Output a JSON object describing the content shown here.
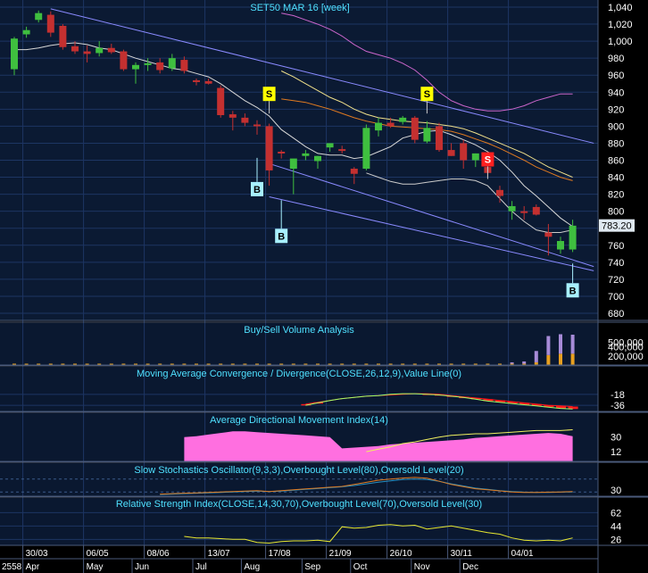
{
  "colors": {
    "panel_bg": "#0b1a33",
    "panel_bg2": "#0a1830",
    "grid": "#1d3563",
    "border": "#4a5a7a",
    "up_candle": "#3fbf3f",
    "down_candle": "#c43030",
    "ma_fast": "#d8d8d8",
    "ma_mid": "#f0e08a",
    "ma_slow": "#e07a20",
    "upper_band": "#cc66cc",
    "lower_band": "#cccccc",
    "trend": "#8a8aff",
    "axis_text": "#ffffff",
    "title_text": "#4fe0ff",
    "volume_buy": "#e8a020",
    "volume_sell": "#a78bd8",
    "macd_line": "#9bff6a",
    "macd_neg": "#ff1a1a",
    "adx_fill": "#ff6fe0",
    "adx_line": "#f0f060",
    "stoch_k": "#e07a20",
    "stoch_d": "#2a8fbf",
    "rsi_line": "#e8e830",
    "price_tag_bg": "#dfe8f0"
  },
  "chart_data": [
    {
      "type": "candlestick",
      "title": "SET50 MAR 16  [week]",
      "ylim": [
        680,
        1040
      ],
      "y_ticks": [
        680,
        700,
        720,
        740,
        760,
        780,
        800,
        820,
        840,
        860,
        880,
        900,
        920,
        940,
        960,
        980,
        1000,
        1020,
        1040
      ],
      "last_price": "783.20",
      "candles": [
        {
          "o": 967,
          "h": 1005,
          "l": 960,
          "c": 1003
        },
        {
          "o": 1008,
          "h": 1017,
          "l": 1004,
          "c": 1013
        },
        {
          "o": 1025,
          "h": 1036,
          "l": 1022,
          "c": 1033
        },
        {
          "o": 1031,
          "h": 1035,
          "l": 1005,
          "c": 1010
        },
        {
          "o": 1018,
          "h": 1020,
          "l": 990,
          "c": 993
        },
        {
          "o": 994,
          "h": 1000,
          "l": 985,
          "c": 988
        },
        {
          "o": 988,
          "h": 995,
          "l": 975,
          "c": 985
        },
        {
          "o": 986,
          "h": 1000,
          "l": 982,
          "c": 992
        },
        {
          "o": 992,
          "h": 997,
          "l": 985,
          "c": 987
        },
        {
          "o": 988,
          "h": 990,
          "l": 965,
          "c": 967
        },
        {
          "o": 967,
          "h": 975,
          "l": 950,
          "c": 972
        },
        {
          "o": 972,
          "h": 980,
          "l": 965,
          "c": 974
        },
        {
          "o": 975,
          "h": 980,
          "l": 962,
          "c": 966
        },
        {
          "o": 968,
          "h": 985,
          "l": 965,
          "c": 980
        },
        {
          "o": 978,
          "h": 982,
          "l": 962,
          "c": 965
        },
        {
          "o": 954,
          "h": 956,
          "l": 948,
          "c": 952
        },
        {
          "o": 953,
          "h": 956,
          "l": 949,
          "c": 950
        },
        {
          "o": 945,
          "h": 948,
          "l": 910,
          "c": 913
        },
        {
          "o": 914,
          "h": 918,
          "l": 895,
          "c": 910
        },
        {
          "o": 910,
          "h": 915,
          "l": 900,
          "c": 904
        },
        {
          "o": 902,
          "h": 907,
          "l": 890,
          "c": 900
        },
        {
          "o": 900,
          "h": 903,
          "l": 830,
          "c": 848
        },
        {
          "o": 870,
          "h": 872,
          "l": 862,
          "c": 868
        },
        {
          "o": 850,
          "h": 858,
          "l": 820,
          "c": 862
        },
        {
          "o": 865,
          "h": 872,
          "l": 860,
          "c": 868
        },
        {
          "o": 859,
          "h": 865,
          "l": 850,
          "c": 865
        },
        {
          "o": 875,
          "h": 880,
          "l": 870,
          "c": 880
        },
        {
          "o": 873,
          "h": 877,
          "l": 868,
          "c": 872
        },
        {
          "o": 850,
          "h": 852,
          "l": 832,
          "c": 844
        },
        {
          "o": 850,
          "h": 902,
          "l": 848,
          "c": 898
        },
        {
          "o": 895,
          "h": 910,
          "l": 888,
          "c": 904
        },
        {
          "o": 904,
          "h": 910,
          "l": 898,
          "c": 900
        },
        {
          "o": 905,
          "h": 912,
          "l": 902,
          "c": 910
        },
        {
          "o": 910,
          "h": 912,
          "l": 880,
          "c": 884
        },
        {
          "o": 882,
          "h": 906,
          "l": 880,
          "c": 898
        },
        {
          "o": 900,
          "h": 904,
          "l": 870,
          "c": 872
        },
        {
          "o": 872,
          "h": 880,
          "l": 865,
          "c": 865
        },
        {
          "o": 880,
          "h": 884,
          "l": 850,
          "c": 860
        },
        {
          "o": 860,
          "h": 868,
          "l": 852,
          "c": 868
        },
        {
          "o": 852,
          "h": 855,
          "l": 840,
          "c": 845
        },
        {
          "o": 825,
          "h": 830,
          "l": 810,
          "c": 818
        },
        {
          "o": 800,
          "h": 812,
          "l": 790,
          "c": 806
        },
        {
          "o": 800,
          "h": 806,
          "l": 790,
          "c": 798
        },
        {
          "o": 805,
          "h": 808,
          "l": 795,
          "c": 796
        },
        {
          "o": 775,
          "h": 785,
          "l": 748,
          "c": 770
        },
        {
          "o": 755,
          "h": 770,
          "l": 750,
          "c": 765
        },
        {
          "o": 755,
          "h": 790,
          "l": 752,
          "c": 783
        }
      ],
      "ma_fast": [
        990,
        990,
        992,
        995,
        997,
        998,
        996,
        992,
        990,
        985,
        980,
        976,
        972,
        968,
        966,
        962,
        958,
        950,
        940,
        930,
        922,
        912,
        896,
        886,
        876,
        868,
        866,
        866,
        862,
        864,
        870,
        876,
        886,
        890,
        894,
        895,
        890,
        884,
        878,
        870,
        860,
        846,
        830,
        818,
        805,
        792,
        782
      ],
      "ma_mid": [
        null,
        null,
        null,
        null,
        null,
        null,
        null,
        null,
        null,
        null,
        null,
        null,
        null,
        null,
        null,
        null,
        null,
        null,
        null,
        null,
        null,
        null,
        965,
        958,
        950,
        942,
        934,
        928,
        920,
        914,
        910,
        908,
        906,
        905,
        904,
        902,
        900,
        897,
        892,
        886,
        880,
        874,
        868,
        860,
        852,
        846,
        840
      ],
      "ma_slow": [
        null,
        null,
        null,
        null,
        null,
        null,
        null,
        null,
        null,
        null,
        null,
        null,
        null,
        null,
        null,
        null,
        null,
        null,
        null,
        null,
        null,
        null,
        932,
        930,
        928,
        924,
        920,
        915,
        910,
        906,
        903,
        900,
        899,
        898,
        897,
        896,
        894,
        890,
        885,
        880,
        874,
        867,
        860,
        852,
        846,
        840,
        836
      ],
      "upper_band": [
        null,
        null,
        null,
        null,
        null,
        null,
        null,
        null,
        null,
        null,
        null,
        null,
        null,
        null,
        null,
        null,
        null,
        null,
        null,
        null,
        null,
        null,
        1033,
        1030,
        1025,
        1020,
        1014,
        1006,
        996,
        988,
        984,
        980,
        974,
        966,
        954,
        940,
        930,
        924,
        920,
        918,
        918,
        920,
        924,
        930,
        934,
        938,
        938
      ],
      "lower_band": [
        null,
        null,
        null,
        null,
        null,
        null,
        null,
        null,
        null,
        null,
        null,
        null,
        null,
        null,
        null,
        null,
        null,
        null,
        null,
        null,
        null,
        null,
        null,
        null,
        null,
        null,
        null,
        null,
        null,
        845,
        840,
        835,
        832,
        832,
        834,
        836,
        838,
        838,
        836,
        830,
        815,
        800,
        788,
        778,
        775,
        775,
        778
      ],
      "trend_lines": [
        {
          "x0": 3,
          "y0": 1038,
          "x1": 47,
          "y1": 880
        },
        {
          "x0": 21,
          "y0": 856,
          "x1": 47,
          "y1": 735
        },
        {
          "x0": 21,
          "y0": 817,
          "x1": 47,
          "y1": 730
        }
      ],
      "signals": [
        {
          "i": 21,
          "label": "S",
          "type": "sell-yellow",
          "price": 938
        },
        {
          "i": 34,
          "label": "S",
          "type": "sell-yellow",
          "price": 938
        },
        {
          "i": 39,
          "label": "S",
          "type": "sell-red",
          "price": 861
        },
        {
          "i": 20,
          "label": "B",
          "type": "buy",
          "price": 826
        },
        {
          "i": 22,
          "label": "B",
          "type": "buy",
          "price": 771
        },
        {
          "i": 46,
          "label": "B",
          "type": "buy",
          "price": 707
        }
      ],
      "x_ticks": [
        {
          "i": 1,
          "label": "30/03"
        },
        {
          "i": 6,
          "label": "06/05"
        },
        {
          "i": 11,
          "label": "08/06"
        },
        {
          "i": 16,
          "label": "13/07"
        },
        {
          "i": 21,
          "label": "17/08"
        },
        {
          "i": 26,
          "label": "21/09"
        },
        {
          "i": 31,
          "label": "26/10"
        },
        {
          "i": 36,
          "label": "30/11"
        },
        {
          "i": 41,
          "label": "04/01"
        }
      ],
      "month_ticks": [
        {
          "i": 1,
          "label": "Apr"
        },
        {
          "i": 6,
          "label": "May"
        },
        {
          "i": 10,
          "label": "Jun"
        },
        {
          "i": 15,
          "label": "Jul"
        },
        {
          "i": 19,
          "label": "Aug"
        },
        {
          "i": 24,
          "label": "Sep"
        },
        {
          "i": 28,
          "label": "Oct"
        },
        {
          "i": 33,
          "label": "Nov"
        },
        {
          "i": 37,
          "label": "Dec"
        }
      ],
      "year_label": "2558"
    },
    {
      "type": "bar",
      "title": "Buy/Sell Volume Analysis",
      "y_ticks": [
        200000,
        400000,
        500000
      ],
      "y_tick_labels": [
        "200,000",
        "400,000",
        "500,000"
      ],
      "ylim": [
        0,
        650000
      ],
      "buy": [
        30000,
        30000,
        30000,
        30000,
        30000,
        30000,
        30000,
        30000,
        30000,
        30000,
        30000,
        30000,
        30000,
        30000,
        30000,
        30000,
        30000,
        30000,
        30000,
        30000,
        30000,
        30000,
        30000,
        30000,
        30000,
        30000,
        30000,
        30000,
        30000,
        30000,
        30000,
        30000,
        30000,
        30000,
        30000,
        30000,
        30000,
        30000,
        30000,
        30000,
        30000,
        30000,
        30000,
        60000,
        220000,
        250000,
        250000
      ],
      "sell": [
        0,
        0,
        0,
        0,
        0,
        0,
        0,
        0,
        0,
        0,
        0,
        0,
        0,
        0,
        0,
        0,
        0,
        0,
        0,
        0,
        0,
        0,
        0,
        0,
        0,
        0,
        0,
        0,
        0,
        0,
        0,
        0,
        0,
        0,
        0,
        0,
        0,
        0,
        0,
        0,
        0,
        30000,
        50000,
        250000,
        420000,
        430000,
        420000
      ]
    },
    {
      "type": "line",
      "title": "Moving Average Convergence / Divergence(CLOSE,26,12,9),Value Line(0)",
      "y_ticks": [
        -18,
        -36
      ],
      "ylim": [
        -46,
        8
      ],
      "macd": [
        null,
        null,
        null,
        null,
        null,
        null,
        null,
        null,
        null,
        null,
        null,
        null,
        null,
        null,
        null,
        null,
        null,
        null,
        null,
        null,
        null,
        null,
        null,
        null,
        -36,
        -32,
        -28,
        -25,
        -23,
        -21,
        -20,
        -18,
        -17,
        -17,
        -18,
        -19,
        -21,
        -23,
        -26,
        -29,
        -31,
        -33,
        -35,
        -37,
        -39,
        -41,
        -42
      ],
      "signal": [
        null,
        null,
        null,
        null,
        null,
        null,
        null,
        null,
        null,
        null,
        null,
        null,
        null,
        null,
        null,
        null,
        null,
        null,
        null,
        null,
        null,
        null,
        null,
        null,
        -34,
        -31,
        -28,
        -25,
        -23,
        -21,
        -20,
        -19,
        -18,
        -17,
        -17,
        -18,
        -20,
        -22,
        -24,
        -26,
        -28,
        -30,
        -32,
        -34,
        -36,
        -37,
        -38
      ]
    },
    {
      "type": "area",
      "title": "Average Directional Movement Index(14)",
      "y_ticks": [
        12,
        30
      ],
      "ylim": [
        0,
        45
      ],
      "adx": [
        null,
        null,
        null,
        null,
        null,
        null,
        null,
        null,
        null,
        null,
        null,
        null,
        null,
        null,
        30,
        31,
        33,
        35,
        37,
        37,
        36,
        35,
        34,
        33,
        32,
        31,
        30,
        16,
        17,
        18,
        19,
        21,
        22,
        23,
        24,
        25,
        26,
        27,
        29,
        30,
        31,
        32,
        33,
        34,
        35,
        34,
        31
      ],
      "di": [
        null,
        null,
        null,
        null,
        null,
        null,
        null,
        null,
        null,
        null,
        null,
        null,
        null,
        null,
        null,
        null,
        null,
        null,
        null,
        null,
        null,
        null,
        null,
        null,
        null,
        null,
        null,
        null,
        null,
        12,
        15,
        18,
        22,
        24,
        27,
        30,
        32,
        33,
        34,
        34,
        35,
        36,
        37,
        38,
        38,
        38,
        39
      ]
    },
    {
      "type": "line",
      "title": "Slow Stochastics Oscillator(9,3,3),Overbought Level(80),Oversold Level(20)",
      "y_ticks": [
        30
      ],
      "ylim": [
        0,
        100
      ],
      "overbought": 80,
      "oversold": 20,
      "k": [
        null,
        null,
        null,
        null,
        null,
        null,
        null,
        null,
        null,
        null,
        null,
        null,
        10,
        12,
        14,
        16,
        18,
        20,
        22,
        24,
        26,
        22,
        26,
        30,
        34,
        38,
        42,
        46,
        55,
        65,
        75,
        80,
        85,
        88,
        84,
        70,
        55,
        45,
        35,
        30,
        25,
        20,
        18,
        18,
        19,
        20,
        22
      ],
      "d": [
        null,
        null,
        null,
        null,
        null,
        null,
        null,
        null,
        null,
        null,
        null,
        null,
        8,
        10,
        12,
        14,
        16,
        18,
        20,
        22,
        24,
        22,
        24,
        28,
        32,
        36,
        40,
        44,
        50,
        58,
        66,
        72,
        78,
        80,
        78,
        70,
        58,
        48,
        38,
        32,
        26,
        22,
        19,
        18,
        18,
        19,
        20
      ]
    },
    {
      "type": "line",
      "title": "Relative Strength Index(CLOSE,14,30,70),Overbought Level(70),Oversold Level(30)",
      "y_ticks": [
        26,
        44,
        62
      ],
      "ylim": [
        18,
        72
      ],
      "rsi": [
        null,
        null,
        null,
        null,
        null,
        null,
        null,
        null,
        null,
        null,
        null,
        null,
        null,
        null,
        30,
        28,
        28,
        27,
        26,
        26,
        22,
        21,
        23,
        24,
        24,
        25,
        23,
        43,
        41,
        42,
        45,
        46,
        44,
        45,
        40,
        42,
        44,
        41,
        38,
        35,
        33,
        28,
        25,
        24,
        25,
        24,
        28
      ]
    }
  ]
}
